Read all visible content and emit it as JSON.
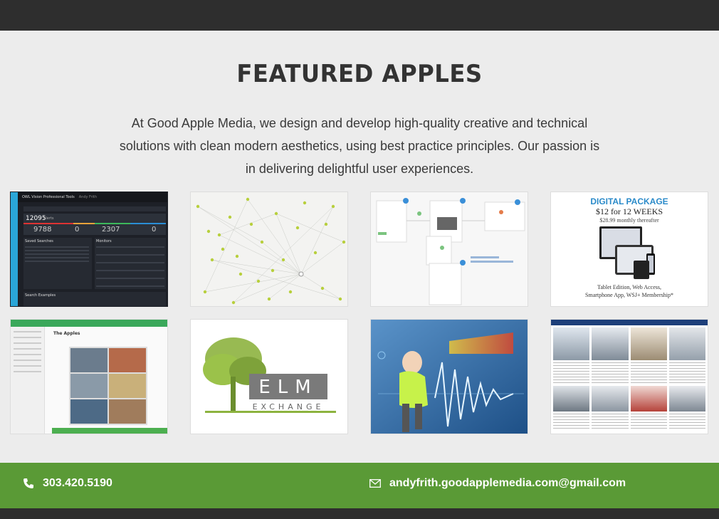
{
  "header": {
    "title": "FEATURED APPLES"
  },
  "intro": {
    "text": "At Good Apple Media, we design and develop high-quality creative and technical solutions with clean modern aesthetics, using best practice principles. Our passion is in delivering delightful user experiences."
  },
  "tiles": {
    "owl": {
      "header": "OWL Vision Professional Tools",
      "user": "Andy Frith",
      "count": "12095",
      "count_label": "Alerts",
      "n1": "9788",
      "n2": "0",
      "n3": "2307",
      "n4": "0",
      "saved": "Saved Searches",
      "monitors": "Monitors",
      "examples": "Search Examples"
    },
    "digital": {
      "title": "DIGITAL PACKAGE",
      "offer": "$12 for 12 WEEKS",
      "price": "$28.99 monthly thereafter",
      "desc1": "Tablet Edition, Web Access,",
      "desc2": "Smartphone App, WSJ+ Membership*"
    },
    "apples": {
      "heading": "The Apples"
    },
    "elm": {
      "word": "ELM",
      "sub": "EXCHANGE"
    }
  },
  "contact": {
    "phone": "303.420.5190",
    "email": "andyfrith.goodapplemedia.com@gmail.com"
  }
}
